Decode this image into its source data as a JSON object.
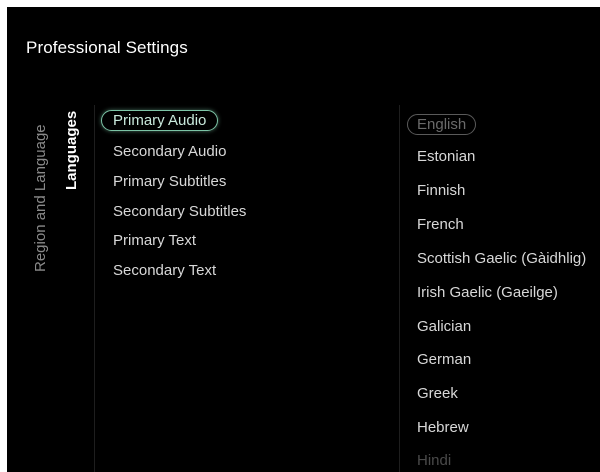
{
  "header": {
    "title": "Professional Settings"
  },
  "breadcrumb": {
    "parent": "Region and Language",
    "current": "Languages"
  },
  "menu": {
    "items": [
      {
        "label": "Primary Audio",
        "selected": true
      },
      {
        "label": "Secondary Audio"
      },
      {
        "label": "Primary Subtitles"
      },
      {
        "label": "Secondary Subtitles"
      },
      {
        "label": "Primary Text"
      },
      {
        "label": "Secondary Text"
      }
    ]
  },
  "languages": {
    "items": [
      {
        "label": "English",
        "selected": true
      },
      {
        "label": "Estonian"
      },
      {
        "label": "Finnish"
      },
      {
        "label": "French"
      },
      {
        "label": "Scottish Gaelic (Gàidhlig)"
      },
      {
        "label": "Irish Gaelic (Gaeilge)"
      },
      {
        "label": "Galician"
      },
      {
        "label": "German"
      },
      {
        "label": "Greek"
      },
      {
        "label": "Hebrew"
      },
      {
        "label": "Hindi"
      }
    ]
  },
  "colors": {
    "background": "#000000",
    "accent": "#7cc4a6"
  }
}
